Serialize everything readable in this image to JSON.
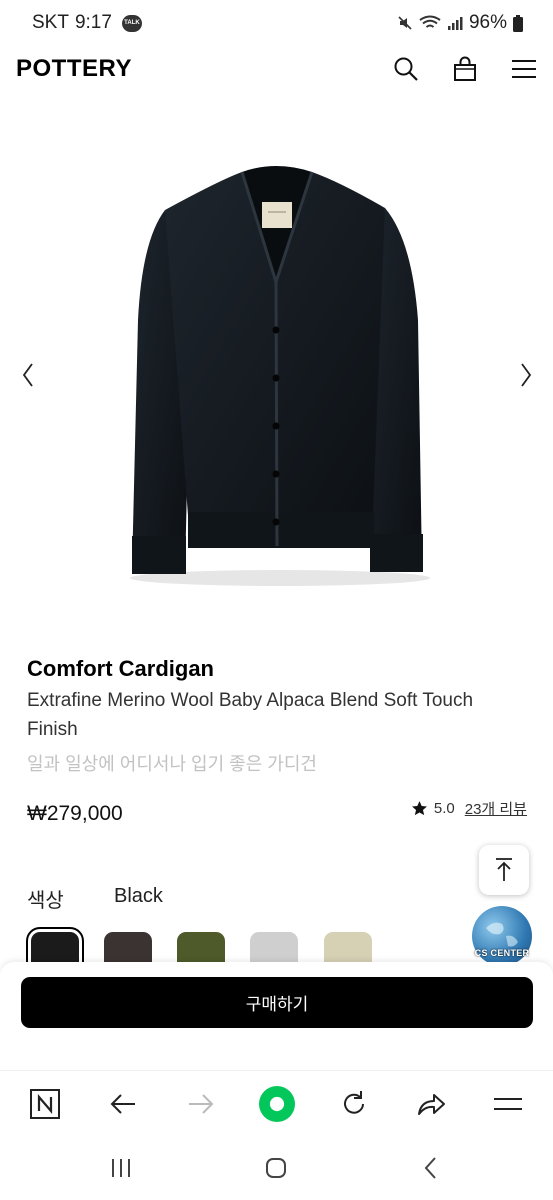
{
  "status_bar": {
    "carrier": "SKT",
    "time": "9:17",
    "talk_badge": "TALK",
    "battery": "96%"
  },
  "header": {
    "logo": "POTTERY",
    "icons": [
      "search-icon",
      "shopping-bag-icon",
      "menu-icon"
    ]
  },
  "gallery": {
    "prev_icon": "chevron-left-icon",
    "next_icon": "chevron-right-icon"
  },
  "product": {
    "name": "Comfort Cardigan",
    "description": "Extrafine Merino Wool Baby Alpaca Blend Soft Touch Finish",
    "subtitle": "일과 일상에 어디서나 입기 좋은 가디건",
    "price": "₩279,000",
    "rating": "5.0",
    "review_link": "23개 리뷰"
  },
  "color": {
    "label": "색상",
    "selected": "Black",
    "swatches": [
      "#1b1b1b",
      "#3b3331",
      "#4f5a2a",
      "#cfcfcf",
      "#d6d0b4"
    ]
  },
  "cs_badge": {
    "label": "CS CENTER"
  },
  "buy_button": {
    "label": "구매하기"
  },
  "browser_bar": {
    "icons": [
      "naver-n-icon",
      "back-arrow-icon",
      "forward-arrow-icon",
      "home-green-icon",
      "refresh-icon",
      "share-icon",
      "menu-icon"
    ]
  },
  "system_nav": {
    "icons": [
      "recent-apps-icon",
      "home-icon",
      "back-icon"
    ]
  },
  "colors": {
    "accent_green": "#03c75a",
    "buy_button": "#000000"
  }
}
